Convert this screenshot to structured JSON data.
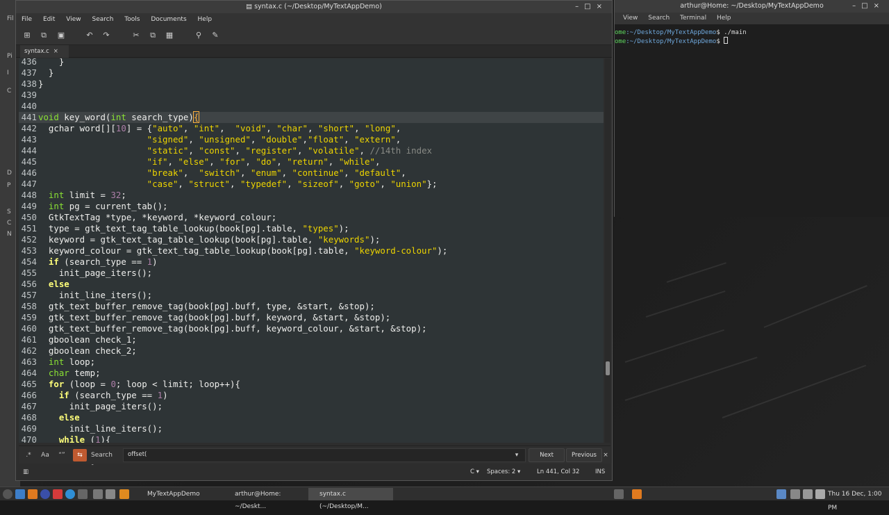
{
  "background_window": {
    "labels": [
      "Fil",
      "Pi",
      "I",
      "C",
      "D",
      "P",
      "S",
      "C",
      "N"
    ]
  },
  "editor": {
    "title": "syntax.c (~/Desktop/MyTextAppDemo)",
    "menu": [
      "File",
      "Edit",
      "View",
      "Search",
      "Tools",
      "Documents",
      "Help"
    ],
    "toolbar_icons": [
      "new-document-icon",
      "open-document-icon",
      "save-icon",
      "undo-icon",
      "redo-icon",
      "cut-icon",
      "copy-icon",
      "paste-icon",
      "search-icon",
      "replace-icon"
    ],
    "tab": {
      "label": "syntax.c",
      "close": "×"
    },
    "code_lines": [
      {
        "n": "436",
        "html": "    }"
      },
      {
        "n": "437",
        "html": "  }"
      },
      {
        "n": "438",
        "html": "}"
      },
      {
        "n": "439",
        "html": ""
      },
      {
        "n": "440",
        "html": ""
      },
      {
        "n": "441",
        "html": "<span class=\"ty\">void</span> key_word(<span class=\"ty\">int</span> search_type)<span class=\"br\">{</span>"
      },
      {
        "n": "442",
        "html": "  gchar word[][<span class=\"nu\">10</span>] = {<span class=\"st\">\"auto\"</span>, <span class=\"st\">\"int\"</span>,  <span class=\"st\">\"void\"</span>, <span class=\"st\">\"char\"</span>, <span class=\"st\">\"short\"</span>, <span class=\"st\">\"long\"</span>,"
      },
      {
        "n": "443",
        "html": "                     <span class=\"st\">\"signed\"</span>, <span class=\"st\">\"unsigned\"</span>, <span class=\"st\">\"double\"</span>,<span class=\"st\">\"float\"</span>, <span class=\"st\">\"extern\"</span>,"
      },
      {
        "n": "444",
        "html": "                     <span class=\"st\">\"static\"</span>, <span class=\"st\">\"const\"</span>, <span class=\"st\">\"register\"</span>, <span class=\"st\">\"volatile\"</span>, <span class=\"cm\">//14th index</span>"
      },
      {
        "n": "445",
        "html": "                     <span class=\"st\">\"if\"</span>, <span class=\"st\">\"else\"</span>, <span class=\"st\">\"for\"</span>, <span class=\"st\">\"do\"</span>, <span class=\"st\">\"return\"</span>, <span class=\"st\">\"while\"</span>,"
      },
      {
        "n": "446",
        "html": "                     <span class=\"st\">\"break\"</span>,  <span class=\"st\">\"switch\"</span>, <span class=\"st\">\"enum\"</span>, <span class=\"st\">\"continue\"</span>, <span class=\"st\">\"default\"</span>,"
      },
      {
        "n": "447",
        "html": "                     <span class=\"st\">\"case\"</span>, <span class=\"st\">\"struct\"</span>, <span class=\"st\">\"typedef\"</span>, <span class=\"st\">\"sizeof\"</span>, <span class=\"st\">\"goto\"</span>, <span class=\"st\">\"union\"</span>};"
      },
      {
        "n": "448",
        "html": "  <span class=\"ty\">int</span> limit = <span class=\"nu\">32</span>;"
      },
      {
        "n": "449",
        "html": "  <span class=\"ty\">int</span> pg = current_tab();"
      },
      {
        "n": "450",
        "html": "  GtkTextTag *type, *keyword, *keyword_colour;"
      },
      {
        "n": "451",
        "html": "  type = gtk_text_tag_table_lookup(book[pg].table, <span class=\"st\">\"types\"</span>);"
      },
      {
        "n": "452",
        "html": "  keyword = gtk_text_tag_table_lookup(book[pg].table, <span class=\"st\">\"keywords\"</span>);"
      },
      {
        "n": "453",
        "html": "  keyword_colour = gtk_text_tag_table_lookup(book[pg].table, <span class=\"st\">\"keyword-colour\"</span>);"
      },
      {
        "n": "454",
        "html": "  <span class=\"kw\">if</span> (search_type == <span class=\"nu\">1</span>)"
      },
      {
        "n": "455",
        "html": "    init_page_iters();"
      },
      {
        "n": "456",
        "html": "  <span class=\"kw\">else</span>"
      },
      {
        "n": "457",
        "html": "    init_line_iters();"
      },
      {
        "n": "458",
        "html": "  gtk_text_buffer_remove_tag(book[pg].buff, type, &amp;start, &amp;stop);"
      },
      {
        "n": "459",
        "html": "  gtk_text_buffer_remove_tag(book[pg].buff, keyword, &amp;start, &amp;stop);"
      },
      {
        "n": "460",
        "html": "  gtk_text_buffer_remove_tag(book[pg].buff, keyword_colour, &amp;start, &amp;stop);"
      },
      {
        "n": "461",
        "html": "  gboolean check_1;"
      },
      {
        "n": "462",
        "html": "  gboolean check_2;"
      },
      {
        "n": "463",
        "html": "  <span class=\"ty\">int</span> loop;"
      },
      {
        "n": "464",
        "html": "  <span class=\"ty\">char</span> temp;"
      },
      {
        "n": "465",
        "html": "  <span class=\"kw\">for</span> (loop = <span class=\"nu\">0</span>; loop &lt; limit; loop++){"
      },
      {
        "n": "466",
        "html": "    <span class=\"kw\">if</span> (search_type == <span class=\"nu\">1</span>)"
      },
      {
        "n": "467",
        "html": "      init_page_iters();"
      },
      {
        "n": "468",
        "html": "    <span class=\"kw\">else</span>"
      },
      {
        "n": "469",
        "html": "      init_line_iters();"
      },
      {
        "n": "470",
        "html": "    <span class=\"kw\">while</span> (<span class=\"nu\">1</span>){"
      }
    ],
    "search": {
      "label": "Search for:",
      "value": "offset(",
      "next": "Next",
      "previous": "Previous"
    },
    "status": {
      "language": "C",
      "spaces": "Spaces: 2",
      "position": "Ln 441, Col 32",
      "mode": "INS"
    }
  },
  "terminal": {
    "title": "arthur@Home: ~/Desktop/MyTextAppDemo",
    "menu": [
      "View",
      "Search",
      "Terminal",
      "Help"
    ],
    "lines": [
      {
        "prompt": "ome",
        "path": ":~/Desktop/MyTextAppDemo",
        "cmd": "$ ./main"
      },
      {
        "prompt": "ome",
        "path": ":~/Desktop/MyTextAppDemo",
        "cmd": "$ "
      }
    ]
  },
  "taskbar": {
    "tasks": [
      "MyTextAppDemo",
      "arthur@Home: ~/Deskt...",
      "syntax.c (~/Desktop/M..."
    ],
    "clock": "Thu 16 Dec, 1:00 PM"
  }
}
